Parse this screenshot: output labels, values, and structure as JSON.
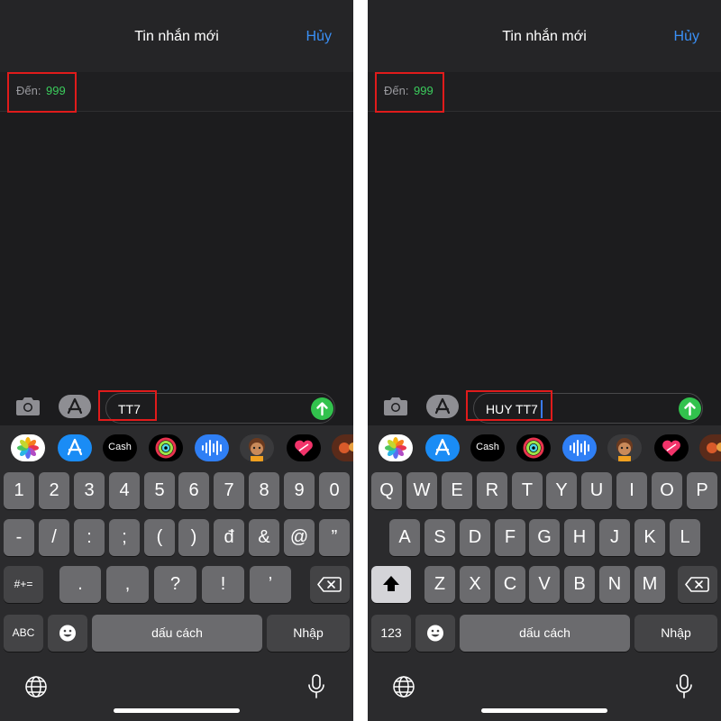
{
  "screens": [
    {
      "header": {
        "title": "Tin nhắn mới",
        "cancel_label": "Hủy"
      },
      "recipient": {
        "label": "Đến:",
        "value": "999"
      },
      "message": {
        "text": "TT7"
      },
      "app_strip": {
        "icons": [
          "photos-icon",
          "app-store-icon",
          "apple-cash-icon",
          "activity-icon",
          "audio-message-icon",
          "memoji-icon",
          "digital-touch-icon",
          "sticker-icon"
        ],
        "cash_label": "Cash"
      },
      "keyboard": {
        "row1": [
          "1",
          "2",
          "3",
          "4",
          "5",
          "6",
          "7",
          "8",
          "9",
          "0"
        ],
        "row2": [
          "-",
          "/",
          ":",
          ";",
          "(",
          ")",
          "đ",
          "&",
          "@",
          "”"
        ],
        "row3_mode_label": "#+=",
        "row3": [
          ".",
          ",",
          "?",
          "!",
          "’"
        ],
        "mode_label": "ABC",
        "space_label": "dấu cách",
        "return_label": "Nhập"
      }
    },
    {
      "header": {
        "title": "Tin nhắn mới",
        "cancel_label": "Hủy"
      },
      "recipient": {
        "label": "Đến:",
        "value": "999"
      },
      "message": {
        "text": "HUY TT7"
      },
      "app_strip": {
        "icons": [
          "photos-icon",
          "app-store-icon",
          "apple-cash-icon",
          "activity-icon",
          "audio-message-icon",
          "memoji-icon",
          "digital-touch-icon",
          "sticker-icon"
        ],
        "cash_label": "Cash"
      },
      "keyboard": {
        "row1": [
          "Q",
          "W",
          "E",
          "R",
          "T",
          "Y",
          "U",
          "I",
          "O",
          "P"
        ],
        "row2": [
          "A",
          "S",
          "D",
          "F",
          "G",
          "H",
          "J",
          "K",
          "L"
        ],
        "row3": [
          "Z",
          "X",
          "C",
          "V",
          "B",
          "N",
          "M"
        ],
        "mode_label": "123",
        "space_label": "dấu cách",
        "return_label": "Nhập"
      }
    }
  ],
  "colors": {
    "accent": "#3a8ff5",
    "recipient": "#3bcc5c",
    "send": "#32c24d",
    "highlight": "#e01b1b",
    "cursor": "#3a7bf5"
  }
}
